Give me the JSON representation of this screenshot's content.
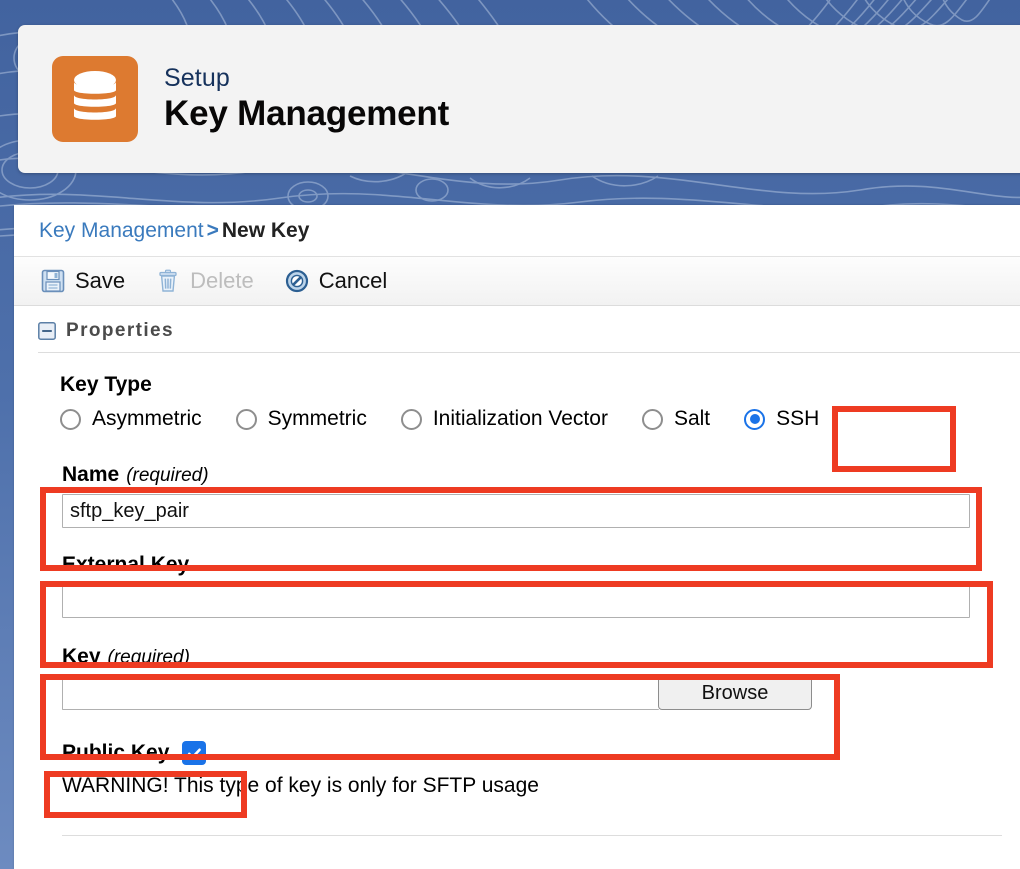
{
  "background": {
    "pattern_name": "topographic-contour-pattern",
    "color_top": "#42639f",
    "color_bottom": "#6d8bc0"
  },
  "setup_header": {
    "icon_name": "database-stack-icon",
    "icon_color": "#dd7a30",
    "eyebrow": "Setup",
    "title": "Key Management"
  },
  "breadcrumb": {
    "parent": "Key Management",
    "separator": ">",
    "current": "New Key",
    "link_color": "#3a7abd"
  },
  "toolbar": {
    "save_label": "Save",
    "save_icon": "floppy-disk-icon",
    "delete_label": "Delete",
    "delete_icon": "trash-icon",
    "delete_disabled": true,
    "cancel_label": "Cancel",
    "cancel_icon": "circle-slash-icon"
  },
  "properties_section": {
    "label": "Properties",
    "toggle_icon": "collapse-minus-icon",
    "expanded": true
  },
  "form": {
    "key_type": {
      "label": "Key Type",
      "options": [
        {
          "label": "Asymmetric",
          "checked": false
        },
        {
          "label": "Symmetric",
          "checked": false
        },
        {
          "label": "Initialization Vector",
          "checked": false
        },
        {
          "label": "Salt",
          "checked": false
        },
        {
          "label": "SSH",
          "checked": true
        }
      ],
      "selected": "SSH"
    },
    "name": {
      "label": "Name",
      "required_text": "(required)",
      "value": "sftp_key_pair",
      "placeholder": ""
    },
    "external_key": {
      "label": "External Key",
      "required_text": "",
      "value": "",
      "placeholder": ""
    },
    "key_file": {
      "label": "Key",
      "required_text": "(required)",
      "value": "",
      "placeholder": "",
      "browse_label": "Browse"
    },
    "public_key": {
      "label": "Public Key",
      "checked": true,
      "checkbox_color": "#1a73e8",
      "check_icon": "checkmark-icon"
    },
    "warning": "WARNING! This type of key is only for SFTP usage"
  },
  "annotations": {
    "highlight_color": "#ee3b22",
    "boxes": [
      {
        "name": "ssh-radio-highlight",
        "target": "SSH"
      },
      {
        "name": "name-field-highlight",
        "target": "Name"
      },
      {
        "name": "external-key-field-highlight",
        "target": "External Key"
      },
      {
        "name": "key-file-field-highlight",
        "target": "Key"
      },
      {
        "name": "public-key-checkbox-highlight",
        "target": "Public Key"
      }
    ]
  }
}
